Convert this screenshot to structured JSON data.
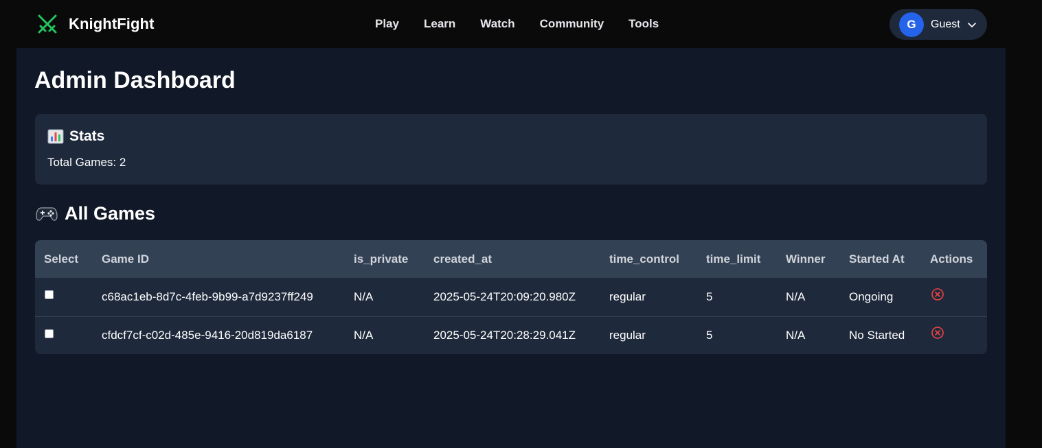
{
  "brand": {
    "name": "KnightFight",
    "logo_icon": "crossed-swords-icon",
    "accent": "#22c55e"
  },
  "nav": {
    "items": [
      "Play",
      "Learn",
      "Watch",
      "Community",
      "Tools"
    ]
  },
  "user": {
    "initial": "G",
    "name": "Guest",
    "avatar_color": "#2563eb"
  },
  "page": {
    "title": "Admin Dashboard"
  },
  "stats": {
    "icon": "bar-chart-icon",
    "title": "Stats",
    "total_games_label": "Total Games:",
    "total_games_value": "2"
  },
  "games": {
    "icon": "gamepad-icon",
    "title": "All Games",
    "columns": [
      "Select",
      "Game ID",
      "is_private",
      "created_at",
      "time_control",
      "time_limit",
      "Winner",
      "Started At",
      "Actions"
    ],
    "rows": [
      {
        "selected": false,
        "game_id": "c68ac1eb-8d7c-4feb-9b99-a7d9237ff249",
        "is_private": "N/A",
        "created_at": "2025-05-24T20:09:20.980Z",
        "time_control": "regular",
        "time_limit": "5",
        "winner": "N/A",
        "started_at": "Ongoing",
        "action_icon": "delete-circle-x-icon"
      },
      {
        "selected": false,
        "game_id": "cfdcf7cf-c02d-485e-9416-20d819da6187",
        "is_private": "N/A",
        "created_at": "2025-05-24T20:28:29.041Z",
        "time_control": "regular",
        "time_limit": "5",
        "winner": "N/A",
        "started_at": "No Started",
        "action_icon": "delete-circle-x-icon"
      }
    ],
    "danger_color": "#ef4444"
  }
}
